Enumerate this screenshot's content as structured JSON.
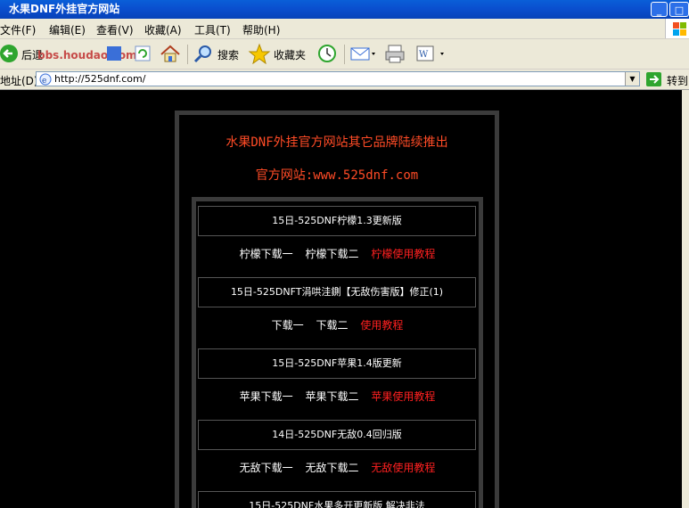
{
  "window": {
    "title": "水果DNF外挂官方网站"
  },
  "menu": [
    "文件(F)",
    "编辑(E)",
    "查看(V)",
    "收藏(A)",
    "工具(T)",
    "帮助(H)"
  ],
  "toolbar": {
    "back": "后退",
    "watermark": "bbs.houdao.com",
    "search": "搜索",
    "favorites": "收藏夹"
  },
  "address": {
    "label": "地址(D)",
    "url": "http://525dnf.com/",
    "go": "转到"
  },
  "page": {
    "headline1": "水果DNF外挂官方网站其它品牌陆续推出",
    "headline2": "官方网站:www.525dnf.com",
    "items": [
      {
        "title": "15日-525DNF柠檬1.3更新版",
        "link1": "柠檬下载一",
        "link2": "柠檬下载二",
        "guide": "柠檬使用教程"
      },
      {
        "title": "15日-525DNFT涓哄洼鍘【无敌伤害版】修正(1)",
        "link1": "下载一",
        "link2": "下载二",
        "guide": "使用教程"
      },
      {
        "title": "15日-525DNF苹果1.4版更新",
        "link1": "苹果下载一",
        "link2": "苹果下载二",
        "guide": "苹果使用教程"
      },
      {
        "title": "14日-525DNF无敌0.4回归版",
        "link1": "无敌下载一",
        "link2": "无敌下载二",
        "guide": "无敌使用教程"
      },
      {
        "title": "15日-525DNF水果多开更新版 解决非法"
      }
    ]
  }
}
